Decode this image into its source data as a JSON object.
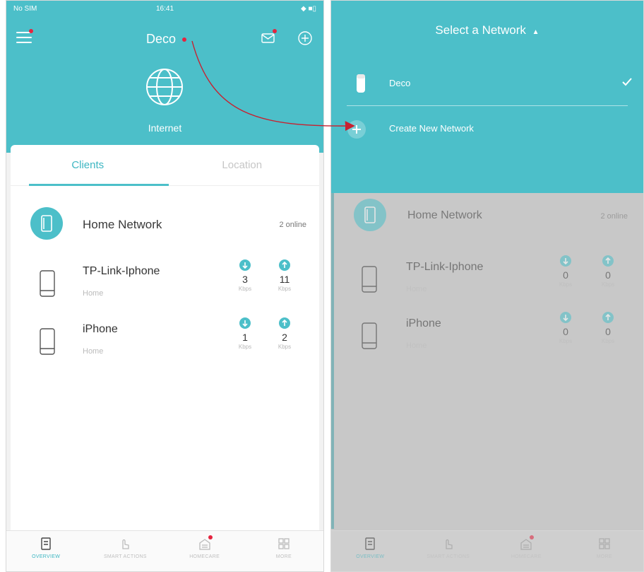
{
  "status_bar": {
    "carrier": "No SIM",
    "time": "16:41",
    "battery": "◆ ■▯"
  },
  "header": {
    "title": "Deco",
    "menu_icon": "menu-icon",
    "mail_icon": "mail-icon",
    "add_icon": "add-circle-icon"
  },
  "internet": {
    "label": "Internet",
    "icon": "globe-icon"
  },
  "tabs": [
    {
      "label": "Clients"
    },
    {
      "label": "Location"
    }
  ],
  "network": {
    "name": "Home Network",
    "online": "2 online"
  },
  "clients_left": [
    {
      "name": "TP-Link-Iphone",
      "location": "Home",
      "down": "3",
      "up": "11",
      "unit": "Kbps"
    },
    {
      "name": "iPhone",
      "location": "Home",
      "down": "1",
      "up": "2",
      "unit": "Kbps"
    }
  ],
  "clients_right": [
    {
      "name": "TP-Link-Iphone",
      "location": "Home",
      "down": "0",
      "up": "0",
      "unit": "Kbps"
    },
    {
      "name": "iPhone",
      "location": "Home",
      "down": "0",
      "up": "0",
      "unit": "Kbps"
    }
  ],
  "bottom_nav": [
    {
      "label": "OVERVIEW"
    },
    {
      "label": "SMART ACTIONS"
    },
    {
      "label": "HOMECARE"
    },
    {
      "label": "MORE"
    }
  ],
  "dropdown": {
    "title": "Select a Network",
    "items": [
      {
        "label": "Deco",
        "selected": true
      },
      {
        "label": "Create New Network",
        "selected": false
      }
    ]
  },
  "colors": {
    "accent": "#4cbfc9",
    "arrow": "#c8202f",
    "badge": "#e5243f"
  }
}
